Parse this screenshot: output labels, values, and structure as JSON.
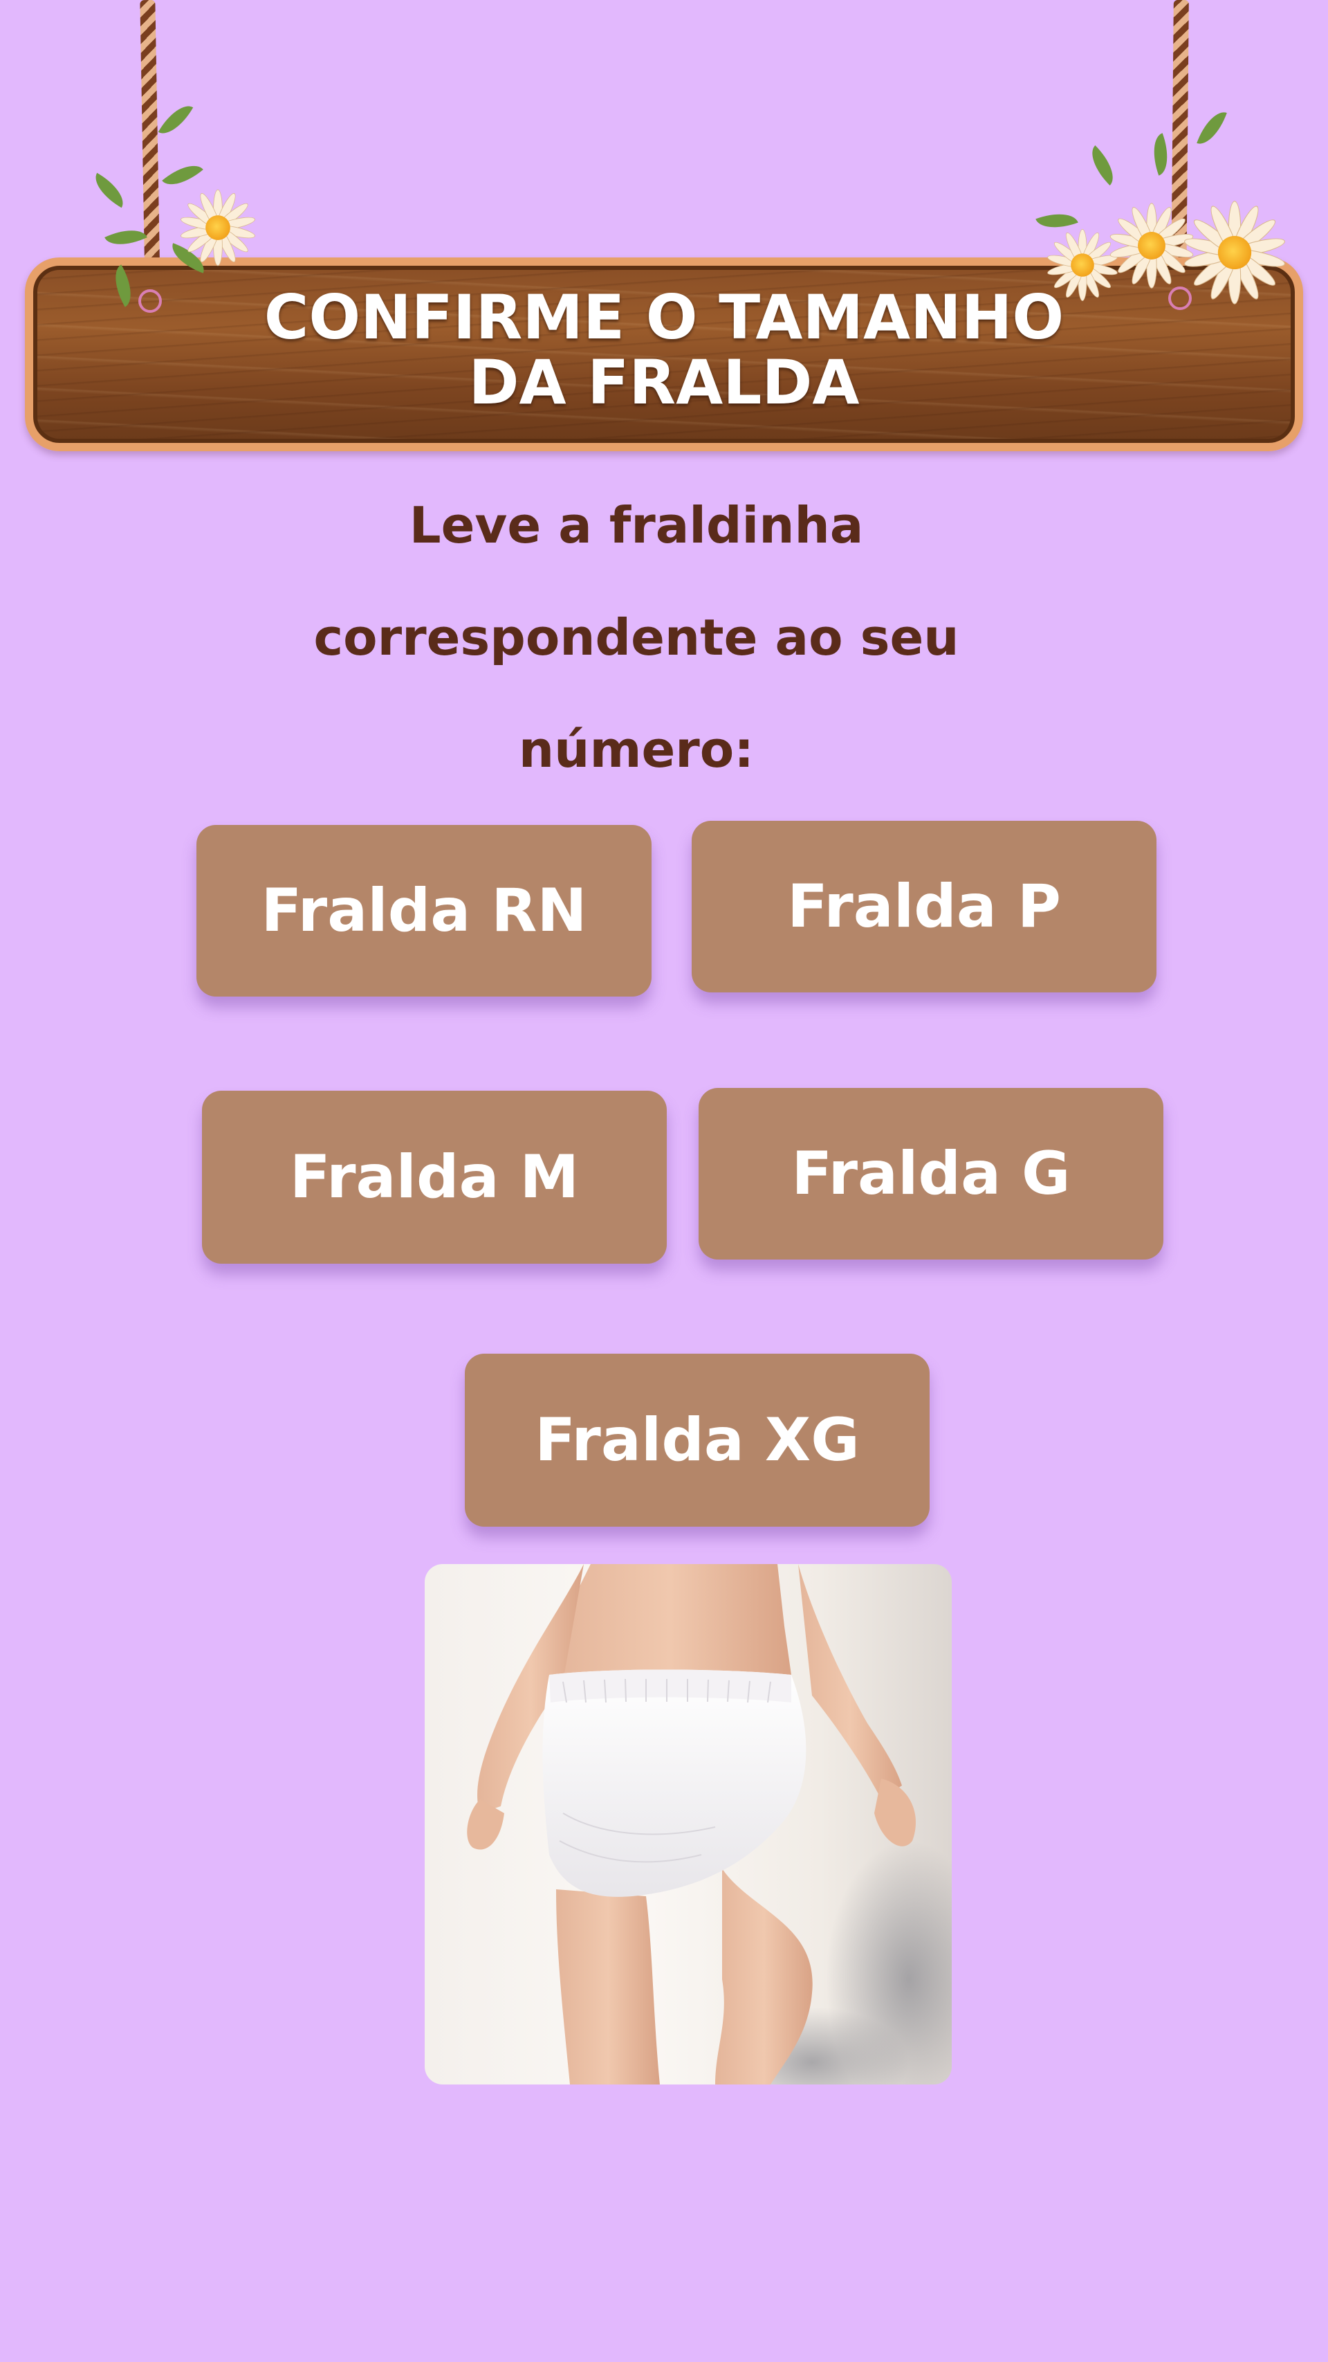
{
  "sign": {
    "title_line1": "CONFIRME O TAMANHO",
    "title_line2": "DA FRALDA"
  },
  "instructions": {
    "line1": "Leve a fraldinha",
    "line2": "correspondente ao seu",
    "line3": "número:"
  },
  "size_options": [
    {
      "label": "Fralda RN"
    },
    {
      "label": "Fralda P"
    },
    {
      "label": "Fralda M"
    },
    {
      "label": "Fralda G"
    },
    {
      "label": "Fralda XG"
    }
  ],
  "colors": {
    "background": "#e2b8fd",
    "button": "#b48669",
    "button_text": "#ffffff",
    "instruction_text": "#5a2b1a",
    "sign_wood": "#8a4f26",
    "sign_border": "#e7a069"
  },
  "icons": {
    "decoration_left": "daisy-flower-icon",
    "decoration_right": "daisy-flower-icon"
  }
}
